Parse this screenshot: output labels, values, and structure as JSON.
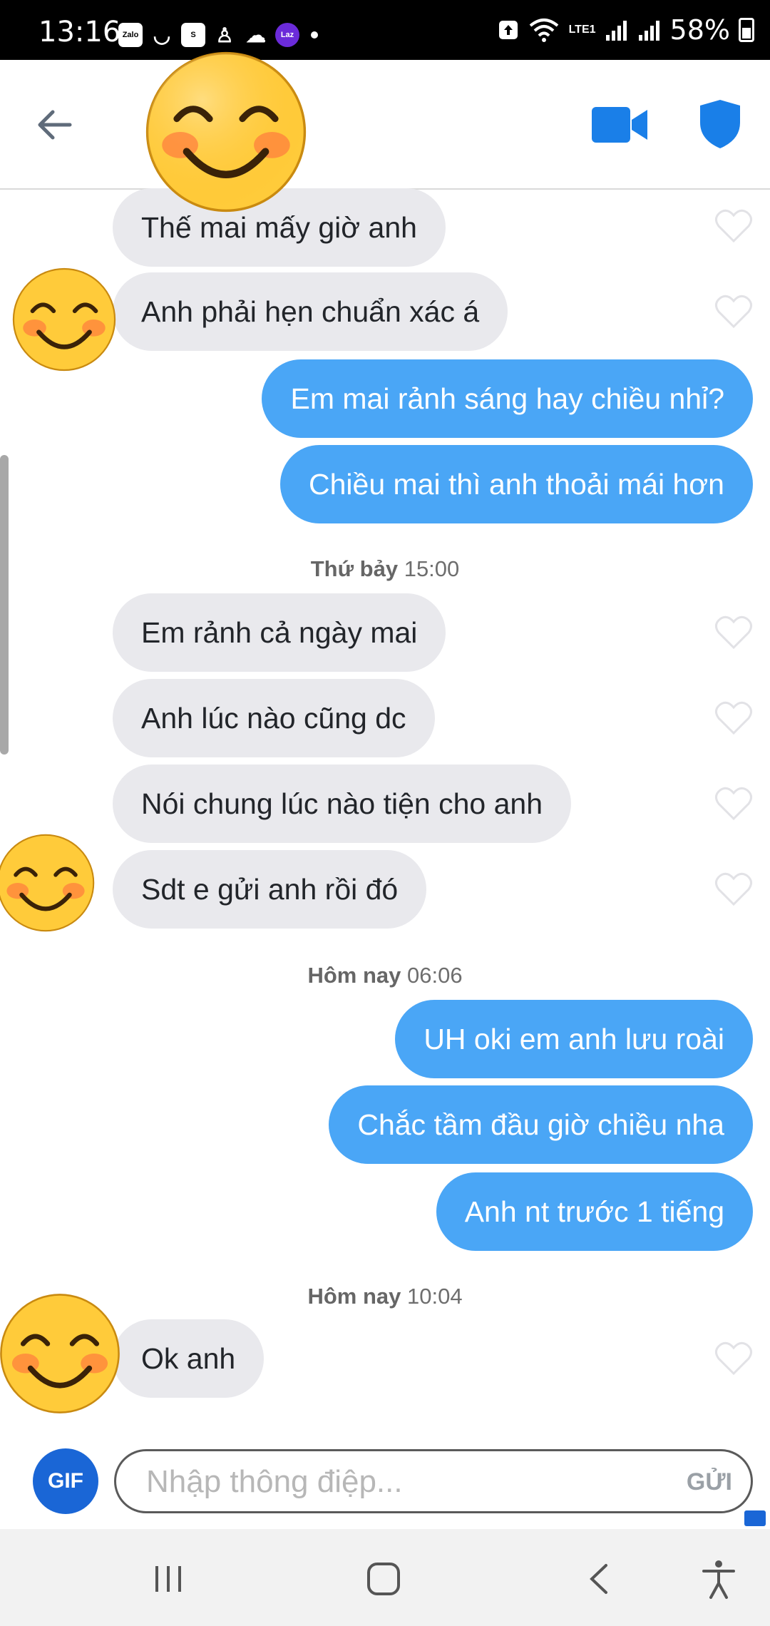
{
  "status_bar": {
    "time": "13:16",
    "notif_icons": [
      "Zalo",
      "Laz"
    ],
    "network_label": "LTE1",
    "battery": "58%"
  },
  "header": {
    "back_icon": "arrow-left-icon",
    "video_icon": "video-camera-icon",
    "safety_icon": "shield-icon",
    "accent_color": "#1a7fe8"
  },
  "messages": [
    {
      "dir": "in",
      "text": "Thế mai mấy giờ anh"
    },
    {
      "dir": "in",
      "text": "Anh phải hẹn chuẩn xác á"
    },
    {
      "dir": "out",
      "text": "Em mai rảnh sáng hay chiều nhỉ?"
    },
    {
      "dir": "out",
      "text": "Chiều mai thì anh thoải mái hơn"
    },
    {
      "timestamp_day": "Thứ bảy",
      "timestamp_time": "15:00"
    },
    {
      "dir": "in",
      "text": "Em rảnh cả ngày mai"
    },
    {
      "dir": "in",
      "text": "Anh lúc nào cũng dc"
    },
    {
      "dir": "in",
      "text": "Nói chung lúc nào tiện cho anh"
    },
    {
      "dir": "in",
      "text": "Sdt e gửi anh rồi đó"
    },
    {
      "timestamp_day": "Hôm nay",
      "timestamp_time": "06:06"
    },
    {
      "dir": "out",
      "text": "UH oki em anh lưu roài"
    },
    {
      "dir": "out",
      "text": "Chắc tầm đầu giờ chiều nha"
    },
    {
      "dir": "out",
      "text": "Anh nt trước 1 tiếng"
    },
    {
      "timestamp_day": "Hôm nay",
      "timestamp_time": "10:04"
    },
    {
      "dir": "in",
      "text": "Ok anh"
    }
  ],
  "composer": {
    "gif_label": "GIF",
    "placeholder": "Nhập thông điệp...",
    "send_label": "GỬI"
  },
  "colors": {
    "incoming_bubble": "#e9e9ed",
    "outgoing_bubble": "#4aa6f6",
    "gif_button": "#1a66d6"
  }
}
